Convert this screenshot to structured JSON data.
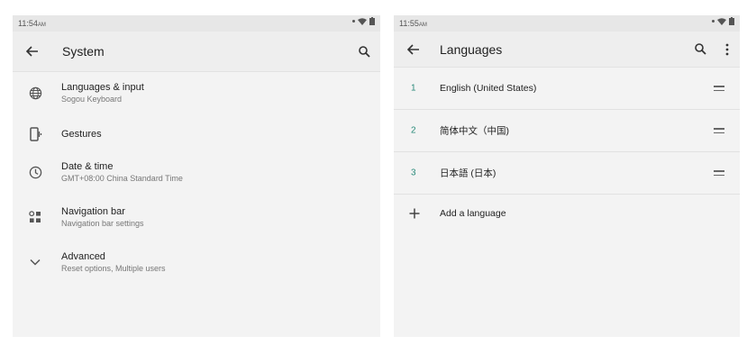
{
  "left_screen": {
    "status": {
      "time": "11:54",
      "ampm": "AM"
    },
    "appbar": {
      "title": "System",
      "back_icon": "arrow-back-icon",
      "search_icon": "search-icon"
    },
    "items": [
      {
        "title": "Languages & input",
        "subtitle": "Sogou Keyboard",
        "icon": "globe-icon"
      },
      {
        "title": "Gestures",
        "subtitle": "",
        "icon": "phone-gesture-icon"
      },
      {
        "title": "Date & time",
        "subtitle": "GMT+08:00 China Standard Time",
        "icon": "clock-icon"
      },
      {
        "title": "Navigation bar",
        "subtitle": "Navigation bar settings",
        "icon": "navigation-bar-icon"
      },
      {
        "title": "Advanced",
        "subtitle": "Reset options, Multiple users",
        "icon": "chevron-down-icon"
      }
    ]
  },
  "right_screen": {
    "status": {
      "time": "11:55",
      "ampm": "AM"
    },
    "appbar": {
      "title": "Languages",
      "back_icon": "arrow-back-icon",
      "search_icon": "search-icon",
      "more_icon": "more-vert-icon"
    },
    "languages": [
      {
        "number": "1",
        "name": "English (United States)"
      },
      {
        "number": "2",
        "name": "简体中文（中国)"
      },
      {
        "number": "3",
        "name": "日本語 (日本)"
      }
    ],
    "add_language": "Add a language"
  },
  "colors": {
    "accent_number": "#2a8a7a",
    "panel_bg": "#f3f3f3",
    "statusbar_bg": "#e7e7e7"
  }
}
